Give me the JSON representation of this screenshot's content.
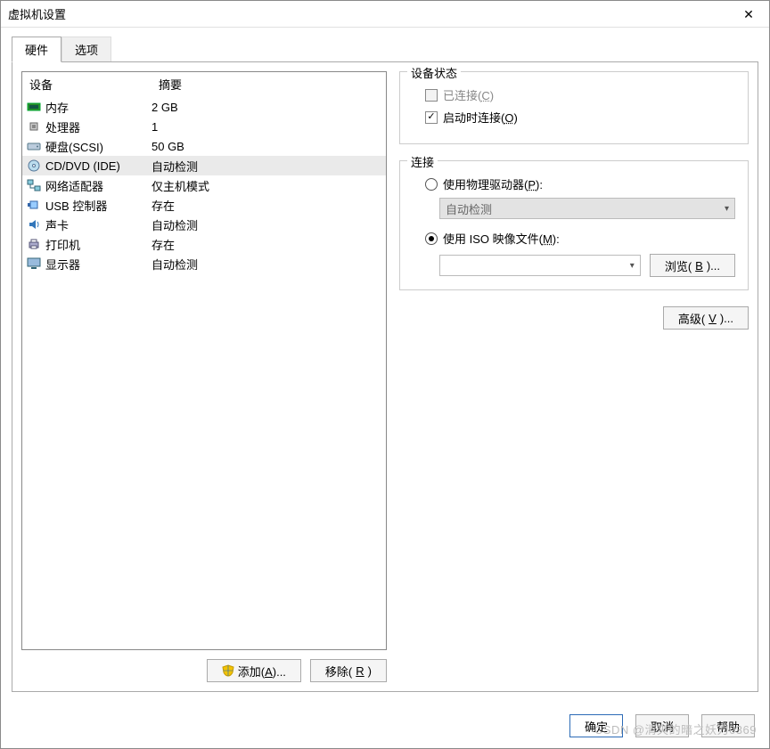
{
  "window": {
    "title": "虚拟机设置"
  },
  "tabs": {
    "hardware": "硬件",
    "options": "选项"
  },
  "deviceList": {
    "col1": "设备",
    "col2": "摘要",
    "rows": [
      {
        "icon": "memory",
        "name": "内存",
        "summary": "2 GB"
      },
      {
        "icon": "cpu",
        "name": "处理器",
        "summary": "1"
      },
      {
        "icon": "hdd",
        "name": "硬盘(SCSI)",
        "summary": "50 GB"
      },
      {
        "icon": "cd",
        "name": "CD/DVD (IDE)",
        "summary": "自动检测",
        "selected": true
      },
      {
        "icon": "net",
        "name": "网络适配器",
        "summary": "仅主机模式"
      },
      {
        "icon": "usb",
        "name": "USB 控制器",
        "summary": "存在"
      },
      {
        "icon": "sound",
        "name": "声卡",
        "summary": "自动检测"
      },
      {
        "icon": "printer",
        "name": "打印机",
        "summary": "存在"
      },
      {
        "icon": "display",
        "name": "显示器",
        "summary": "自动检测"
      }
    ]
  },
  "leftButtons": {
    "add": "添加(A)...",
    "remove": "移除(R)"
  },
  "status": {
    "legend": "设备状态",
    "connected": "已连接(C)",
    "connectAtPowerOn": "启动时连接(O)"
  },
  "connection": {
    "legend": "连接",
    "usePhysical": "使用物理驱动器(P):",
    "physicalCombo": "自动检测",
    "useIso": "使用 ISO 映像文件(M):",
    "isoPath": "",
    "browse": "浏览(B)..."
  },
  "advanced": "高级(V)...",
  "footer": {
    "ok": "确定",
    "cancel": "取消",
    "help": "帮助"
  },
  "watermark": "CSDN @清爽的暗之妖刀0369"
}
